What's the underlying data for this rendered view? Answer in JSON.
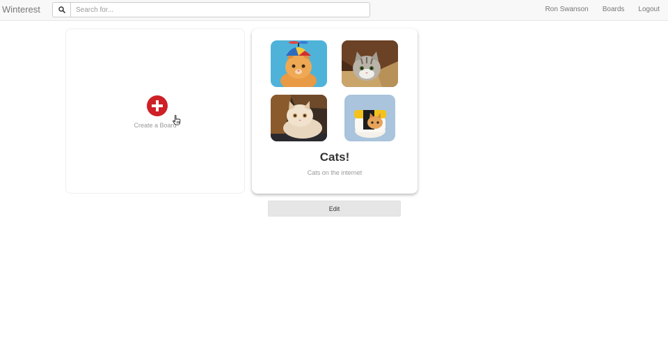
{
  "navbar": {
    "brand": "Winterest",
    "search": {
      "placeholder": "Search for...",
      "value": "",
      "icon": "search-icon"
    },
    "links": [
      "Ron Swanson",
      "Boards",
      "Logout"
    ]
  },
  "create_board": {
    "label": "Create a Board",
    "icon": "plus-circle-icon",
    "icon_color": "#cd2027"
  },
  "board": {
    "title": "Cats!",
    "description": "Cats on the internet",
    "edit_label": "Edit"
  }
}
